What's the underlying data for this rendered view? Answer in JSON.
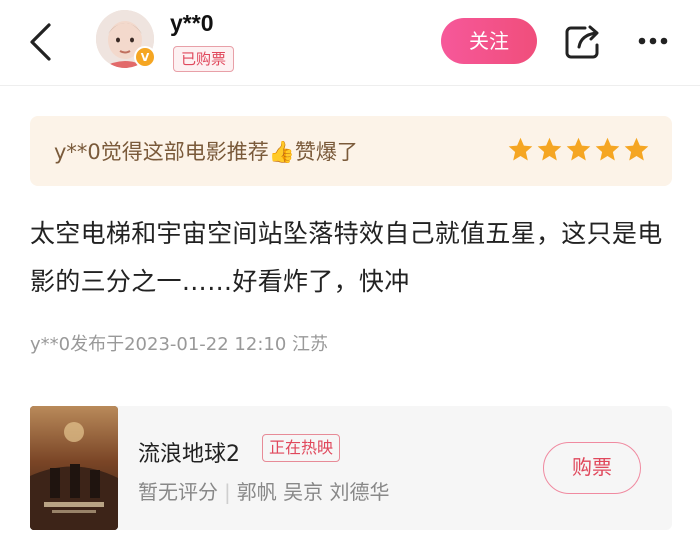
{
  "header": {
    "username": "y**0",
    "badge": "已购票",
    "follow_label": "关注"
  },
  "rating": {
    "text": "y**0觉得这部电影推荐👍赞爆了",
    "stars": 5,
    "star_color": "#f5a623"
  },
  "review": {
    "content": "太空电梯和宇宙空间站坠落特效自己就值五星，这只是电影的三分之一……好看炸了，快冲",
    "meta": "y**0发布于2023-01-22 12:10  江苏"
  },
  "movie": {
    "title": "流浪地球2",
    "status": "正在热映",
    "rating_text": "暂无评分",
    "cast": "郭帆 吴京 刘德华",
    "buy_label": "购票"
  },
  "colors": {
    "accent": "#f04e7b",
    "banner_bg": "#fcf3e8"
  }
}
